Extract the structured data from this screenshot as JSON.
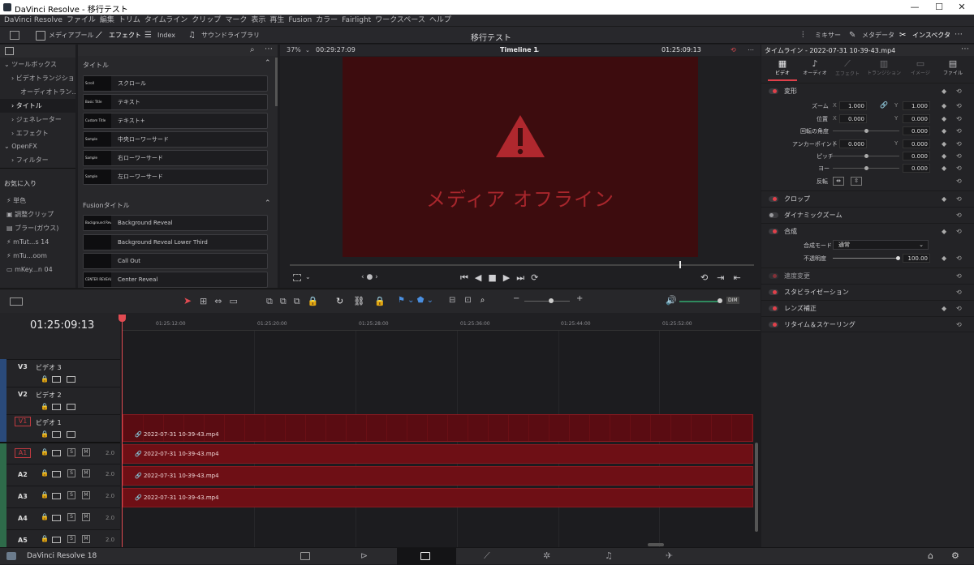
{
  "window": {
    "title": "DaVinci Resolve - 移行テスト",
    "min": "—",
    "max": "☐",
    "close": "✕"
  },
  "menu": [
    "DaVinci Resolve",
    "ファイル",
    "編集",
    "トリム",
    "タイムライン",
    "クリップ",
    "マーク",
    "表示",
    "再生",
    "Fusion",
    "カラー",
    "Fairlight",
    "ワークスペース",
    "ヘルプ"
  ],
  "toolbar": {
    "media_pool": "メディアプール",
    "effects": "エフェクト",
    "index": "Index",
    "sound_library": "サウンドライブラリ",
    "project_title": "移行テスト",
    "mixer": "ミキサー",
    "metadata": "メタデータ",
    "inspector": "インスペクタ"
  },
  "toolbox": {
    "items": [
      {
        "label": "ツールボックス",
        "indent": 0
      },
      {
        "label": "ビデオトランジション",
        "indent": 1
      },
      {
        "label": "オーディオトラン...",
        "indent": 1
      },
      {
        "label": "タイトル",
        "indent": 1
      },
      {
        "label": "ジェネレーター",
        "indent": 1
      },
      {
        "label": "エフェクト",
        "indent": 1
      },
      {
        "label": "OpenFX",
        "indent": 0
      },
      {
        "label": "フィルター",
        "indent": 1
      }
    ],
    "favorites_heading": "お気に入り",
    "favorites": [
      "単色",
      "調整クリップ",
      "ブラー(ガウス)",
      "mTut...s 14",
      "mTu...oom",
      "mKey...n 04"
    ]
  },
  "effects": {
    "titles_heading": "タイトル",
    "titles": [
      {
        "thumb": "Scroll",
        "label": "スクロール"
      },
      {
        "thumb": "Basic Title",
        "label": "テキスト"
      },
      {
        "thumb": "Custom Title",
        "label": "テキスト+"
      },
      {
        "thumb": "Sample",
        "label": "中央ローワーサード"
      },
      {
        "thumb": "Sample",
        "label": "右ローワーサード"
      },
      {
        "thumb": "Sample",
        "label": "左ローワーサード"
      }
    ],
    "fusion_heading": "Fusionタイトル",
    "fusion": [
      {
        "thumb": "Background Reveal",
        "label": "Background Reveal"
      },
      {
        "thumb": "",
        "label": "Background Reveal Lower Third"
      },
      {
        "thumb": "",
        "label": "Call Out"
      },
      {
        "thumb": "CENTER REVEAL",
        "label": "Center Reveal"
      }
    ]
  },
  "viewer": {
    "zoom": "37%",
    "duration": "00:29:27:09",
    "timeline_name": "Timeline 1",
    "timecode": "01:25:09:13",
    "offline_text": "メディア オフライン",
    "scrub_position": 0.84
  },
  "inspector": {
    "header": "タイムライン - 2022-07-31 10-39-43.mp4",
    "tabs": [
      "ビデオ",
      "オーディオ",
      "エフェクト",
      "トランジション",
      "イメージ",
      "ファイル"
    ],
    "transform": {
      "title": "変形",
      "zoom": {
        "label": "ズーム",
        "x": "1.000",
        "y": "1.000"
      },
      "position": {
        "label": "位置",
        "x": "0.000",
        "y": "0.000"
      },
      "rotation": {
        "label": "回転の角度",
        "value": "0.000"
      },
      "anchor": {
        "label": "アンカーポイント",
        "x": "0.000",
        "y": "0.000"
      },
      "pitch": {
        "label": "ピッチ",
        "value": "0.000"
      },
      "yaw": {
        "label": "ヨー",
        "value": "0.000"
      },
      "flip": {
        "label": "反転"
      }
    },
    "sections": [
      "クロップ",
      "ダイナミックズーム",
      "合成"
    ],
    "composite": {
      "mode_label": "合成モード",
      "mode_value": "通常",
      "opacity_label": "不透明度",
      "opacity_value": "100.00"
    },
    "sections2": [
      "速度変更",
      "スタビライゼーション",
      "レンズ補正",
      "リタイム＆スケーリング"
    ]
  },
  "timeline": {
    "timecode": "01:25:09:13",
    "ruler": [
      "01:25:12:00",
      "01:25:20:00",
      "01:25:28:00",
      "01:25:36:00",
      "01:25:44:00",
      "01:25:52:00"
    ],
    "video_tracks": [
      {
        "id": "V3",
        "name": "ビデオ 3"
      },
      {
        "id": "V2",
        "name": "ビデオ 2"
      },
      {
        "id": "V1",
        "name": "ビデオ 1"
      }
    ],
    "audio_tracks": [
      {
        "id": "A1",
        "level": "2.0"
      },
      {
        "id": "A2",
        "level": "2.0"
      },
      {
        "id": "A3",
        "level": "2.0"
      },
      {
        "id": "A4",
        "level": "2.0"
      },
      {
        "id": "A5",
        "level": "2.0"
      }
    ],
    "clip_name": "2022-07-31 10-39-43.mp4",
    "solo": "S",
    "mute": "M"
  },
  "bottom": {
    "app": "DaVinci Resolve 18"
  }
}
